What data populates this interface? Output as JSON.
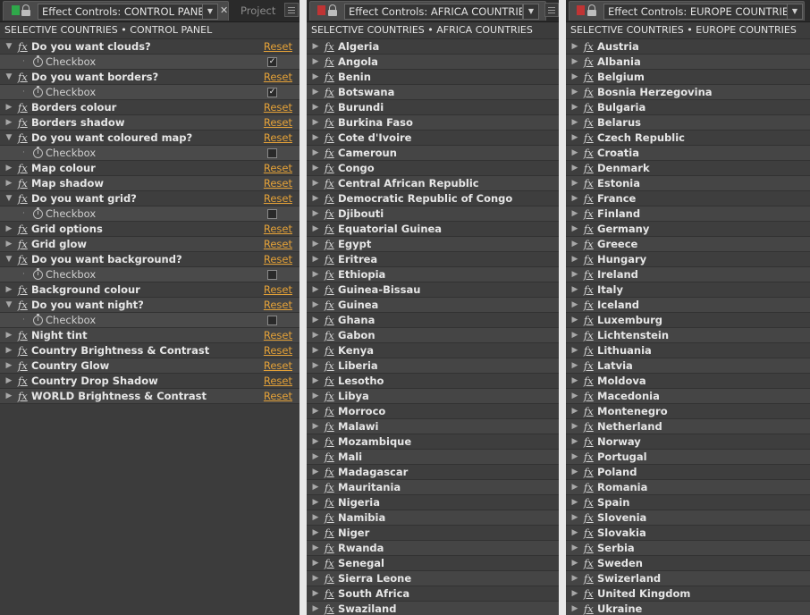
{
  "panels": {
    "control": {
      "tab_title": "Effect Controls: CONTROL PANEL",
      "swatch_color": "#2fa84a",
      "second_tab": "Project",
      "subheader": "SELECTIVE COUNTRIES • CONTROL PANEL",
      "reset_label": "Reset",
      "rows": [
        {
          "type": "effect",
          "label": "Do you want clouds?",
          "expanded": true
        },
        {
          "type": "checkbox",
          "label": "Checkbox",
          "checked": true
        },
        {
          "type": "effect",
          "label": "Do you want borders?",
          "expanded": true
        },
        {
          "type": "checkbox",
          "label": "Checkbox",
          "checked": true
        },
        {
          "type": "effect",
          "label": "Borders colour",
          "expanded": false
        },
        {
          "type": "effect",
          "label": "Borders shadow",
          "expanded": false
        },
        {
          "type": "effect",
          "label": "Do you want coloured map?",
          "expanded": true
        },
        {
          "type": "checkbox",
          "label": "Checkbox",
          "checked": false
        },
        {
          "type": "effect",
          "label": "Map colour",
          "expanded": false
        },
        {
          "type": "effect",
          "label": "Map shadow",
          "expanded": false
        },
        {
          "type": "effect",
          "label": "Do you want grid?",
          "expanded": true
        },
        {
          "type": "checkbox",
          "label": "Checkbox",
          "checked": false
        },
        {
          "type": "effect",
          "label": "Grid options",
          "expanded": false
        },
        {
          "type": "effect",
          "label": "Grid glow",
          "expanded": false
        },
        {
          "type": "effect",
          "label": "Do you want background?",
          "expanded": true
        },
        {
          "type": "checkbox",
          "label": "Checkbox",
          "checked": false
        },
        {
          "type": "effect",
          "label": "Background colour",
          "expanded": false
        },
        {
          "type": "effect",
          "label": "Do you want night?",
          "expanded": true
        },
        {
          "type": "checkbox",
          "label": "Checkbox",
          "checked": false
        },
        {
          "type": "effect",
          "label": "Night tint",
          "expanded": false
        },
        {
          "type": "effect",
          "label": "Country Brightness & Contrast",
          "expanded": false
        },
        {
          "type": "effect",
          "label": "Country Glow",
          "expanded": false
        },
        {
          "type": "effect",
          "label": "Country Drop Shadow",
          "expanded": false
        },
        {
          "type": "effect",
          "label": "WORLD Brightness & Contrast",
          "expanded": false
        }
      ]
    },
    "africa": {
      "tab_title": "Effect Controls: AFRICA COUNTRIES",
      "swatch_color": "#c03434",
      "subheader": "SELECTIVE COUNTRIES • AFRICA COUNTRIES",
      "items": [
        "Algeria",
        "Angola",
        "Benin",
        "Botswana",
        "Burundi",
        "Burkina Faso",
        "Cote d'Ivoire",
        "Cameroun",
        "Congo",
        "Central African Republic",
        "Democratic Republic of Congo",
        "Djibouti",
        "Equatorial Guinea",
        "Egypt",
        "Eritrea",
        "Ethiopia",
        "Guinea-Bissau",
        "Guinea",
        "Ghana",
        "Gabon",
        "Kenya",
        "Liberia",
        "Lesotho",
        "Libya",
        "Morroco",
        "Malawi",
        "Mozambique",
        "Mali",
        "Madagascar",
        "Mauritania",
        "Nigeria",
        "Namibia",
        "Niger",
        "Rwanda",
        "Senegal",
        "Sierra Leone",
        "South Africa",
        "Swaziland"
      ]
    },
    "europe": {
      "tab_title": "Effect Controls: EUROPE COUNTRIES",
      "swatch_color": "#c03434",
      "subheader": "SELECTIVE COUNTRIES • EUROPE COUNTRIES",
      "items": [
        "Austria",
        "Albania",
        "Belgium",
        "Bosnia Herzegovina",
        "Bulgaria",
        "Belarus",
        "Czech Republic",
        "Croatia",
        "Denmark",
        "Estonia",
        "France",
        "Finland",
        "Germany",
        "Greece",
        "Hungary",
        "Ireland",
        "Italy",
        "Iceland",
        "Luxemburg",
        "Lichtenstein",
        "Lithuania",
        "Latvia",
        "Moldova",
        "Macedonia",
        "Montenegro",
        "Netherland",
        "Norway",
        "Portugal",
        "Poland",
        "Romania",
        "Spain",
        "Slovenia",
        "Slovakia",
        "Serbia",
        "Sweden",
        "Swizerland",
        "United Kingdom",
        "Ukraine"
      ]
    }
  }
}
